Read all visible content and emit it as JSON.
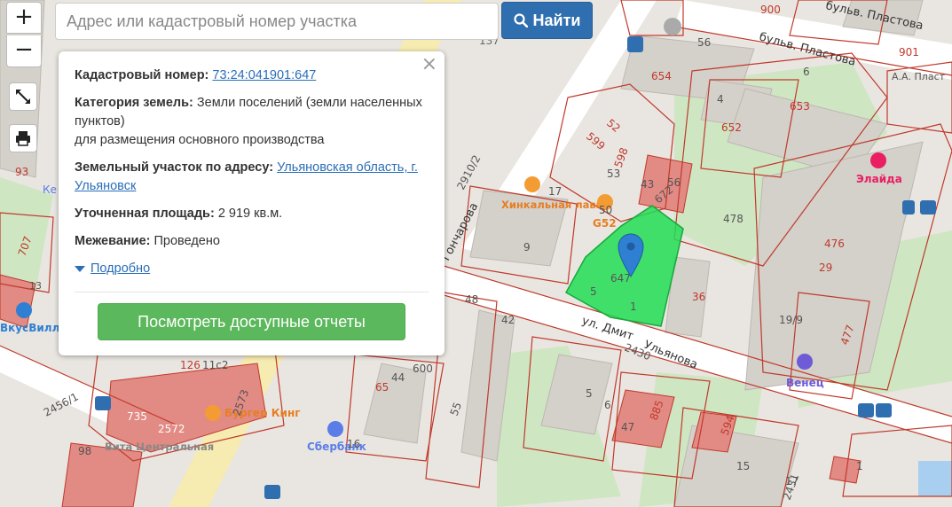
{
  "search": {
    "placeholder": "Адрес или кадастровый номер участка",
    "button_label": "Найти"
  },
  "controls": {
    "zoom_in": "+",
    "zoom_out": "−"
  },
  "popup": {
    "cadastral_label": "Кадастровый номер:",
    "cadastral_value": "73:24:041901:647",
    "category_label": "Категория земель:",
    "category_value": "Земли поселений (земли населенных пунктов)",
    "category_purpose": "для размещения основного производства",
    "address_label": "Земельный участок по адресу:",
    "address_value": "Ульяновская область, г. Ульяновск",
    "area_label": "Уточненная площадь:",
    "area_value": "2 919 кв.м.",
    "survey_label": "Межевание:",
    "survey_value": "Проведено",
    "more_link": "Подробно",
    "reports_button": "Посмотреть доступные отчеты",
    "close": "×"
  },
  "map": {
    "selected_parcel_label": "647",
    "streets": [
      "бульв. Пластова",
      "бульв. Пластова",
      "ул. Дмит",
      "Ульянова",
      "Гончарова",
      "2910/2",
      "2430",
      "2456/1",
      "2431"
    ],
    "pois": [
      "Хинкальная лавка",
      "G52",
      "Элайда",
      "Венец",
      "Сбербанк",
      "Бургер Кинг",
      "Вита Центральная",
      "ВкусВилл",
      "А.А. Пласт"
    ],
    "parcel_numbers": [
      "137",
      "900",
      "901",
      "56",
      "654",
      "6",
      "4",
      "652",
      "653",
      "52",
      "599",
      "598",
      "53",
      "43",
      "672",
      "56",
      "17",
      "50",
      "478",
      "476",
      "29",
      "9",
      "36",
      "19/9",
      "5",
      "1",
      "48",
      "42",
      "600",
      "126",
      "11с2",
      "735",
      "2572",
      "65",
      "44",
      "55",
      "2573",
      "16",
      "5",
      "6",
      "47",
      "885",
      "594",
      "15",
      "17",
      "477",
      "707",
      "93",
      "1",
      "98",
      "13",
      "Ке"
    ]
  },
  "colors": {
    "parcel_selected": "#22dd55",
    "accent": "#2f6eaf",
    "report_button": "#5cb85c",
    "boundary": "#c0392b"
  }
}
